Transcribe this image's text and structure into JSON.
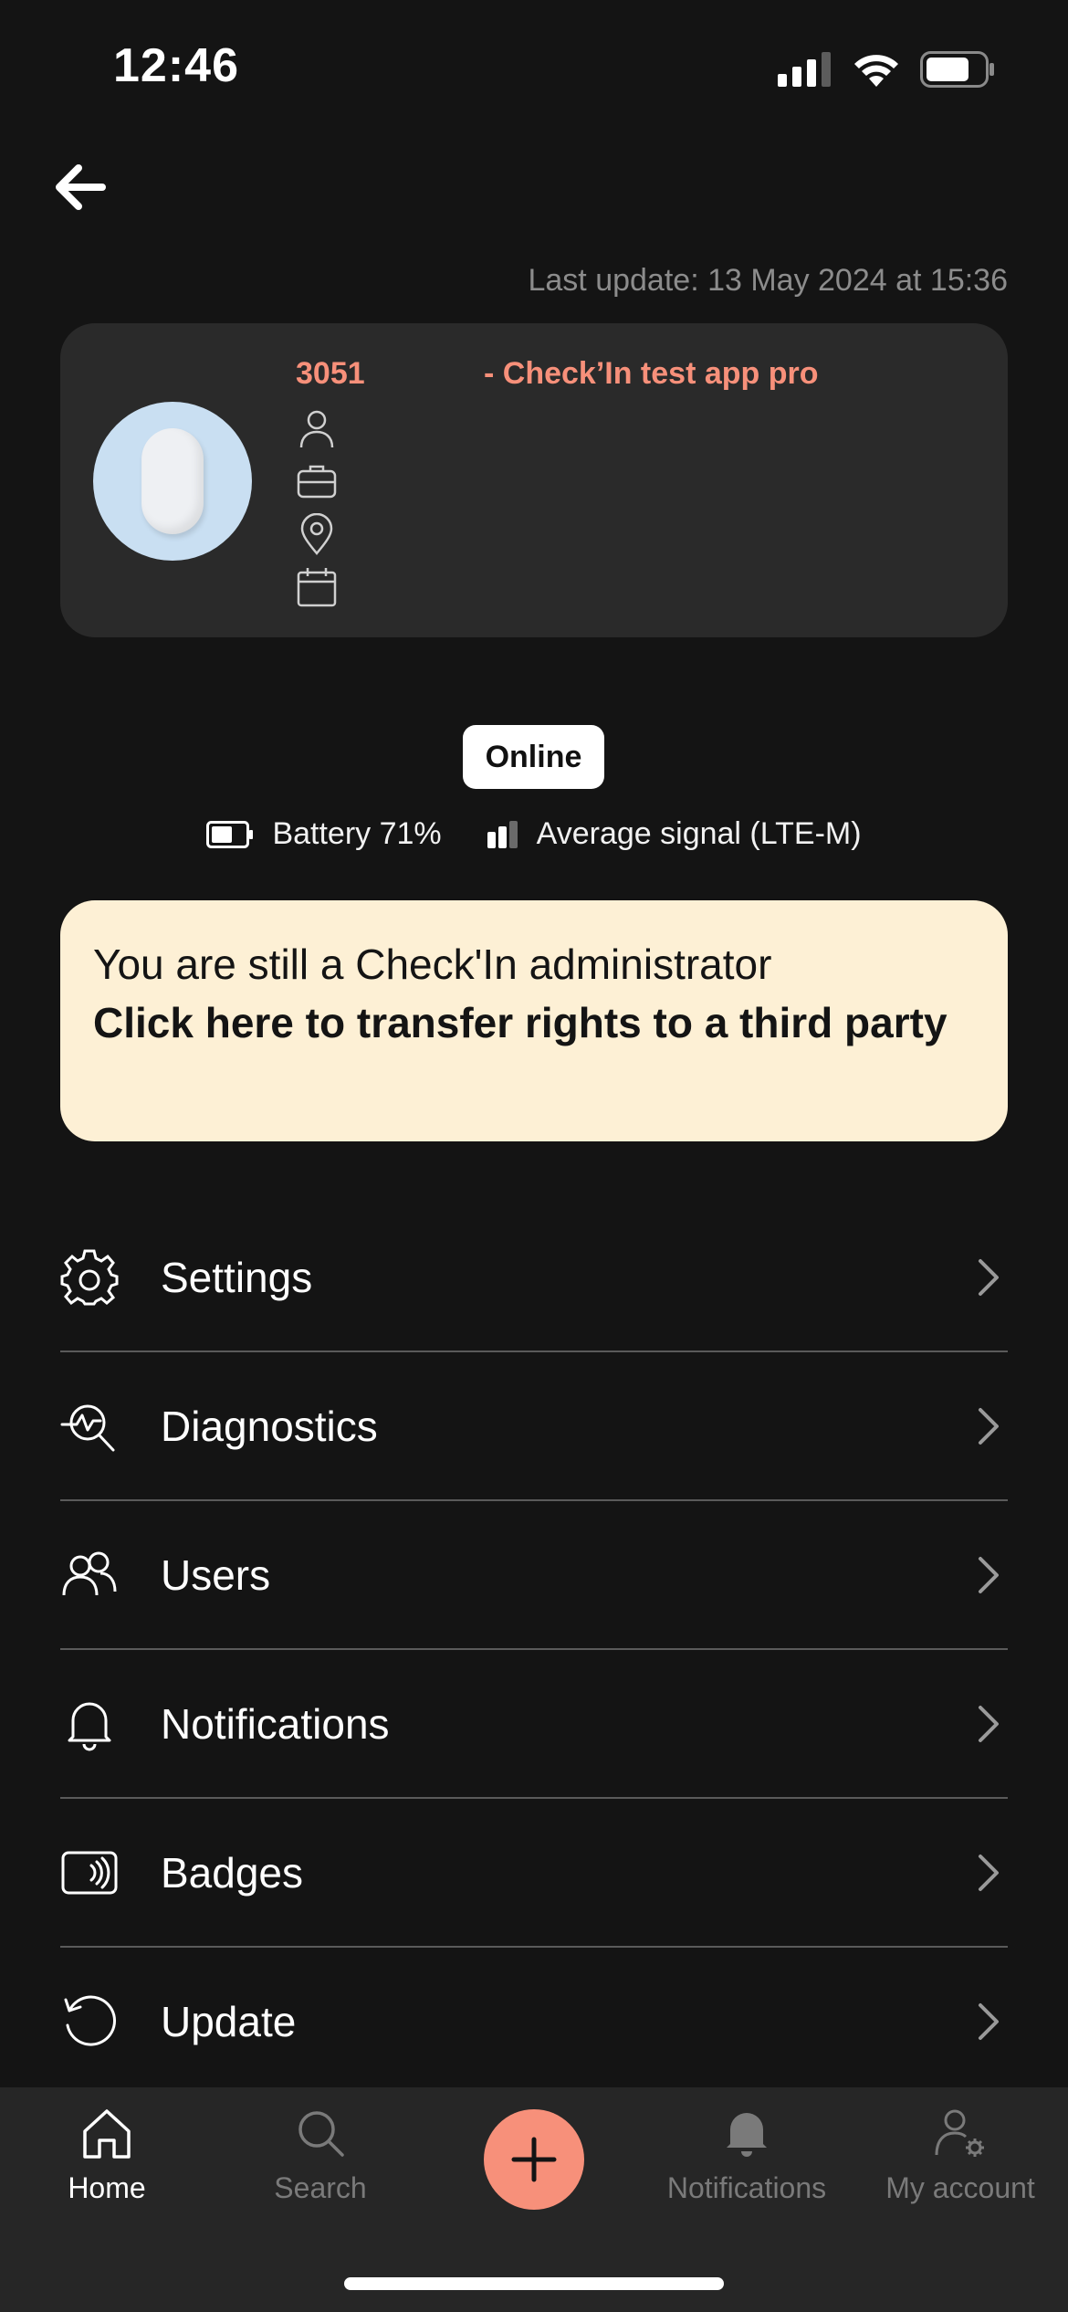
{
  "status_bar": {
    "time": "12:46"
  },
  "header": {
    "last_update": "Last update: 13 May 2024 at 15:36"
  },
  "device": {
    "id": "3051",
    "name": "- Check’In test app pro"
  },
  "status": {
    "online": "Online",
    "battery": "Battery 71%",
    "signal": "Average signal (LTE-M)"
  },
  "admin_banner": {
    "line1": "You are still a Check'In administrator",
    "line2": "Click here to transfer rights to a third party"
  },
  "menu": {
    "items": [
      {
        "label": "Settings",
        "icon": "gear-icon"
      },
      {
        "label": "Diagnostics",
        "icon": "diagnostics-icon"
      },
      {
        "label": "Users",
        "icon": "users-icon"
      },
      {
        "label": "Notifications",
        "icon": "bell-icon"
      },
      {
        "label": "Badges",
        "icon": "badge-icon"
      },
      {
        "label": "Update",
        "icon": "refresh-icon"
      }
    ]
  },
  "tabbar": {
    "home": "Home",
    "search": "Search",
    "notifications": "Notifications",
    "account": "My account"
  },
  "colors": {
    "accent": "#f7907a",
    "banner": "#fdf0d5",
    "background": "#141414",
    "card": "#2a2a2a"
  }
}
